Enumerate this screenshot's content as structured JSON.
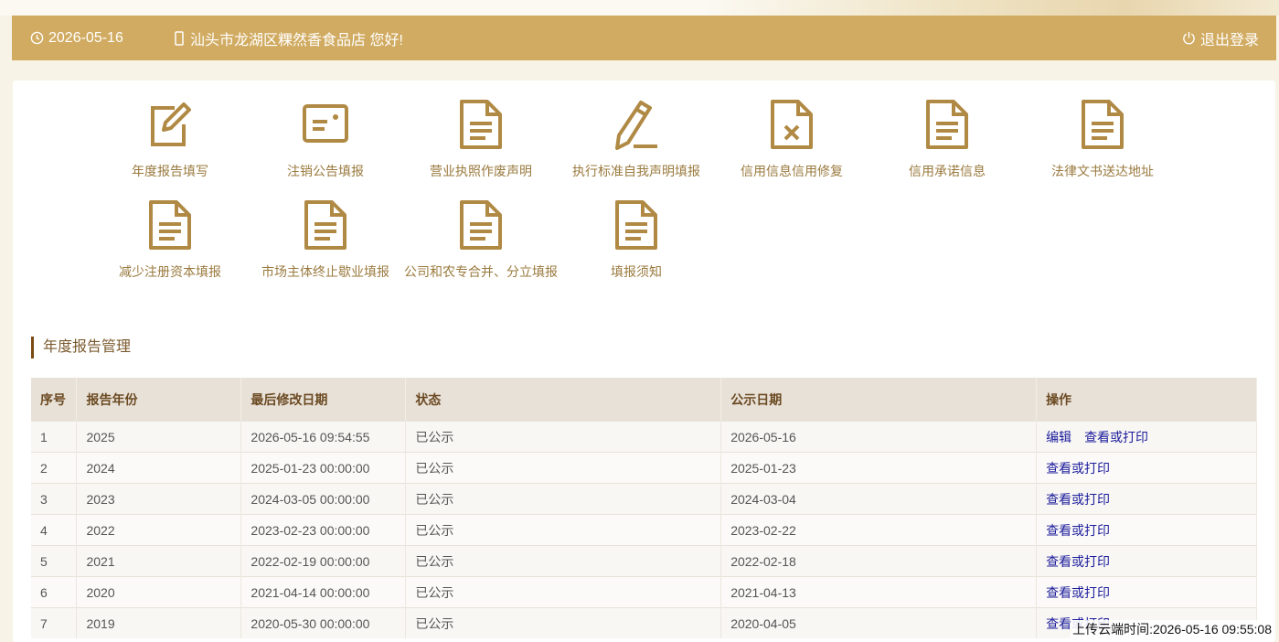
{
  "header": {
    "date": "2026-05-16",
    "greeting": "汕头市龙湖区粿然香食品店 您好!",
    "logout": "退出登录"
  },
  "menu": [
    {
      "label": "年度报告填写",
      "icon": "edit-icon"
    },
    {
      "label": "注销公告填报",
      "icon": "id-card-icon"
    },
    {
      "label": "营业执照作废声明",
      "icon": "document-icon"
    },
    {
      "label": "执行标准自我声明填报",
      "icon": "pen-icon"
    },
    {
      "label": "信用信息信用修复",
      "icon": "document-x-icon"
    },
    {
      "label": "信用承诺信息",
      "icon": "document-icon"
    },
    {
      "label": "法律文书送达地址",
      "icon": "document-icon"
    },
    {
      "label": "减少注册资本填报",
      "icon": "document-icon"
    },
    {
      "label": "市场主体终止歇业填报",
      "icon": "document-icon"
    },
    {
      "label": "公司和农专合并、分立填报",
      "icon": "document-icon"
    },
    {
      "label": "填报须知",
      "icon": "document-icon"
    }
  ],
  "section_title": "年度报告管理",
  "table": {
    "headers": [
      "序号",
      "报告年份",
      "最后修改日期",
      "状态",
      "公示日期",
      "操作"
    ],
    "rows": [
      {
        "no": "1",
        "year": "2025",
        "modified": "2026-05-16 09:54:55",
        "status": "已公示",
        "pub": "2026-05-16",
        "ops": [
          "编辑",
          "查看或打印"
        ]
      },
      {
        "no": "2",
        "year": "2024",
        "modified": "2025-01-23 00:00:00",
        "status": "已公示",
        "pub": "2025-01-23",
        "ops": [
          "查看或打印"
        ]
      },
      {
        "no": "3",
        "year": "2023",
        "modified": "2024-03-05 00:00:00",
        "status": "已公示",
        "pub": "2024-03-04",
        "ops": [
          "查看或打印"
        ]
      },
      {
        "no": "4",
        "year": "2022",
        "modified": "2023-02-23 00:00:00",
        "status": "已公示",
        "pub": "2023-02-22",
        "ops": [
          "查看或打印"
        ]
      },
      {
        "no": "5",
        "year": "2021",
        "modified": "2022-02-19 00:00:00",
        "status": "已公示",
        "pub": "2022-02-18",
        "ops": [
          "查看或打印"
        ]
      },
      {
        "no": "6",
        "year": "2020",
        "modified": "2021-04-14 00:00:00",
        "status": "已公示",
        "pub": "2021-04-13",
        "ops": [
          "查看或打印"
        ]
      },
      {
        "no": "7",
        "year": "2019",
        "modified": "2020-05-30 00:00:00",
        "status": "已公示",
        "pub": "2020-04-05",
        "ops": [
          "查看或打印"
        ]
      }
    ]
  },
  "upload_time": "上传云端时间:2026-05-16 09:55:08",
  "colors": {
    "header": "#d1ab61",
    "icon": "#b08a44",
    "link": "#1c1c9c"
  }
}
